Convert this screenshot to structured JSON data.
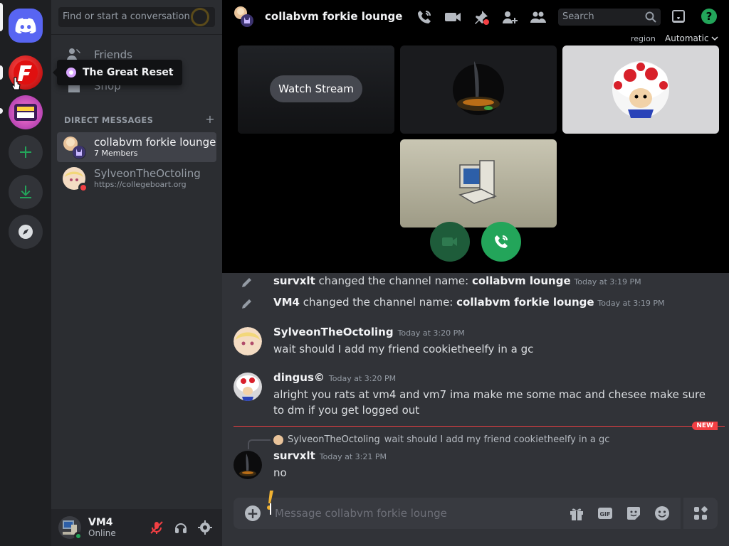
{
  "search": {
    "placeholder": "Find or start a conversation"
  },
  "nav": {
    "friends": "Friends",
    "shop": "Shop"
  },
  "tooltip": {
    "server_name": "The Great Reset"
  },
  "dms": {
    "header": "DIRECT MESSAGES",
    "items": [
      {
        "name": "collabvm forkie lounge",
        "sub": "7 Members"
      },
      {
        "name": "SylveonTheOctoling",
        "sub": "https://collegeboart.org"
      }
    ]
  },
  "user": {
    "name": "VM4",
    "status": "Online"
  },
  "channel": {
    "title": "collabvm forkie lounge"
  },
  "topbar": {
    "search_placeholder": "Search"
  },
  "call": {
    "region_label": "region",
    "region_value": "Automatic",
    "watch_stream": "Watch Stream"
  },
  "messages": {
    "system": [
      {
        "actor": "survxlt",
        "action": "changed the channel name:",
        "value": "collabvm lounge",
        "time": "Today at 3:19 PM"
      },
      {
        "actor": "VM4",
        "action": "changed the channel name:",
        "value": "collabvm forkie lounge",
        "time": "Today at 3:19 PM"
      }
    ],
    "items": [
      {
        "author": "SylveonTheOctoling",
        "time": "Today at 3:20 PM",
        "text": "wait should I add my friend cookietheelfy in a gc"
      },
      {
        "author": "dingus©",
        "time": "Today at 3:20 PM",
        "text": "alright you rats at vm4 and vm7 ima make me some mac and chesee make sure to dm if you get logged out"
      },
      {
        "author": "survxlt",
        "time": "Today at 3:21 PM",
        "text": "no"
      }
    ],
    "new_label": "NEW",
    "reply": {
      "author": "SylveonTheOctoling",
      "text": "wait should I add my friend cookietheelfy in a gc"
    }
  },
  "composer": {
    "placeholder": "Message collabvm forkie lounge"
  },
  "colors": {
    "accent": "#5865f2",
    "green": "#23a55a",
    "red": "#f23f43",
    "new_tag": "#f23f43"
  }
}
